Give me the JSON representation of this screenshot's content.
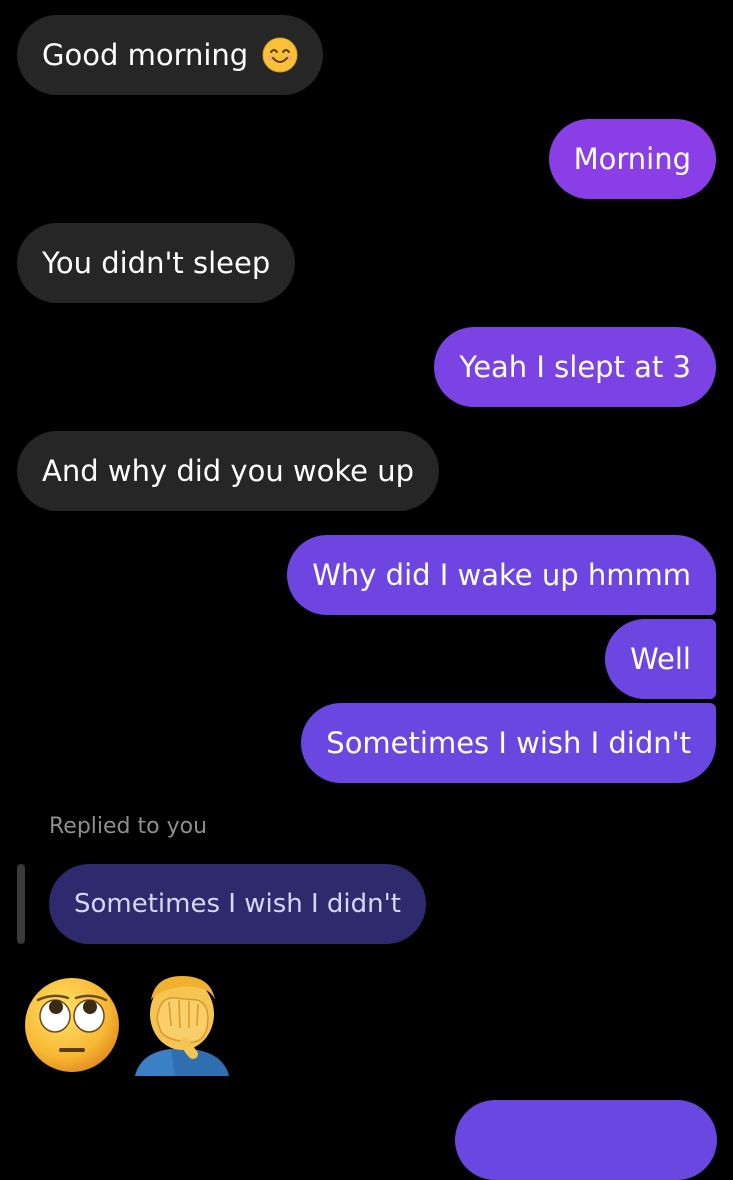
{
  "messages": [
    {
      "from": "them",
      "text": "Good morning",
      "emoji": "smiling-face-icon"
    },
    {
      "from": "me",
      "text": "Morning"
    },
    {
      "from": "them",
      "text": "You didn't sleep"
    },
    {
      "from": "me",
      "text": "Yeah I slept at 3"
    },
    {
      "from": "them",
      "text": "And why did you woke up"
    },
    {
      "from": "me",
      "text": "Why did I wake up hmmm"
    },
    {
      "from": "me",
      "text": "Well"
    },
    {
      "from": "me",
      "text": "Sometimes I wish I didn't"
    }
  ],
  "reply": {
    "label": "Replied to you",
    "quoted_text": "Sometimes I wish I didn't",
    "emojis": [
      "eye-roll-face-icon",
      "facepalm-person-icon"
    ]
  },
  "colors": {
    "background": "#000000",
    "incoming_bubble": "#262626",
    "outgoing_top": "#8a3fe6",
    "outgoing_bottom": "#6a47e0",
    "reply_bubble": "#2e2a6e"
  }
}
